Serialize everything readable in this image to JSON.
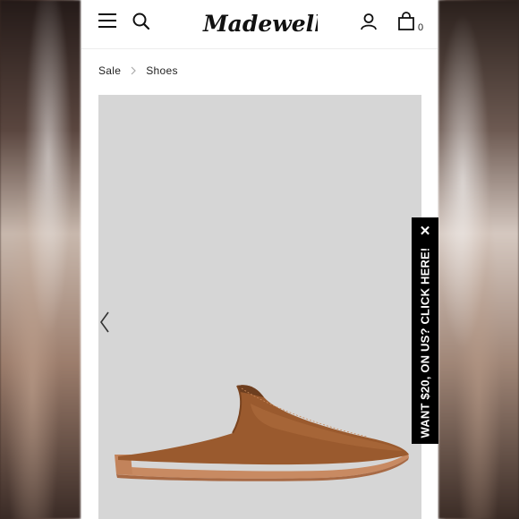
{
  "header": {
    "logo_text": "Madewell",
    "menu_icon": "hamburger-menu-icon",
    "search_icon": "search-icon",
    "account_icon": "account-user-icon",
    "bag_icon": "shopping-bag-icon",
    "bag_count": "0"
  },
  "breadcrumb": {
    "items": [
      "Sale",
      "Shoes"
    ],
    "separator_icon": "chevron-right-icon"
  },
  "product": {
    "image_description_icon": "leather-mule-shoe",
    "prev_arrow_icon": "chevron-left-icon"
  },
  "promo": {
    "text": "WANT $20, ON US? CLICK HERE!",
    "close_label": "✕"
  },
  "colors": {
    "shoe_leather": "#9a5a2e",
    "image_bg": "#d6d6d6",
    "promo_bg": "#000000"
  }
}
